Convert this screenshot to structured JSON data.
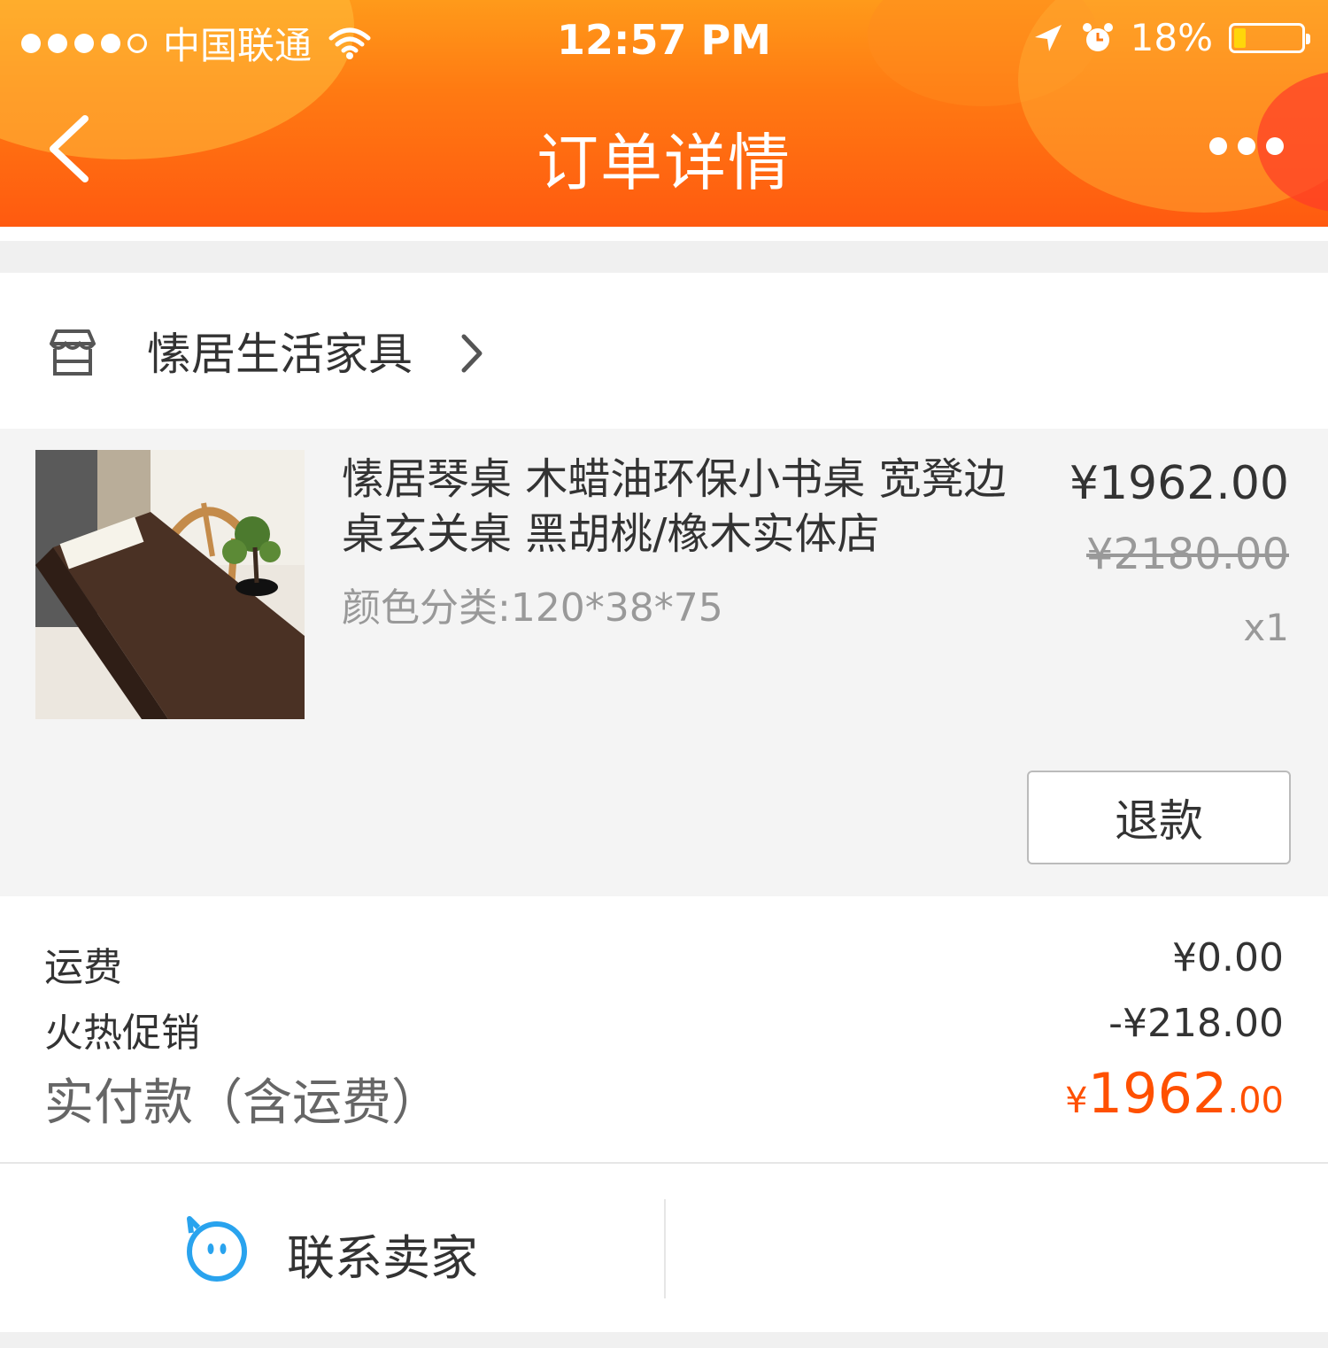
{
  "status_bar": {
    "carrier": "中国联通",
    "time": "12:57 PM",
    "battery": "18%",
    "battery_level": 0.18,
    "signal_bars": 4,
    "signal_max": 5
  },
  "nav": {
    "title": "订单详情",
    "back_icon": "chevron-left-icon",
    "more_icon": "more-dots-icon"
  },
  "shop": {
    "name": "愫居生活家具",
    "icon": "store-icon"
  },
  "item": {
    "title": "愫居琴桌 木蜡油环保小书桌 宽凳边桌玄关桌 黑胡桃/橡木实体店",
    "sku": "颜色分类:120*38*75",
    "price": "¥1962.00",
    "original_price": "¥2180.00",
    "quantity": "x1",
    "refund_label": "退款"
  },
  "summary": {
    "shipping_label": "运费",
    "shipping_value": "¥0.00",
    "promo_label": "火热促销",
    "promo_value": "-¥218.00",
    "paid_label": "实付款（含运费）",
    "paid_currency": "¥",
    "paid_int": "1962",
    "paid_dec": ".00"
  },
  "bottom": {
    "contact_label": "联系卖家"
  },
  "colors": {
    "header_orange": "#ff6a12",
    "price_accent": "#ff5000",
    "contact_blue": "#29a3ee"
  }
}
